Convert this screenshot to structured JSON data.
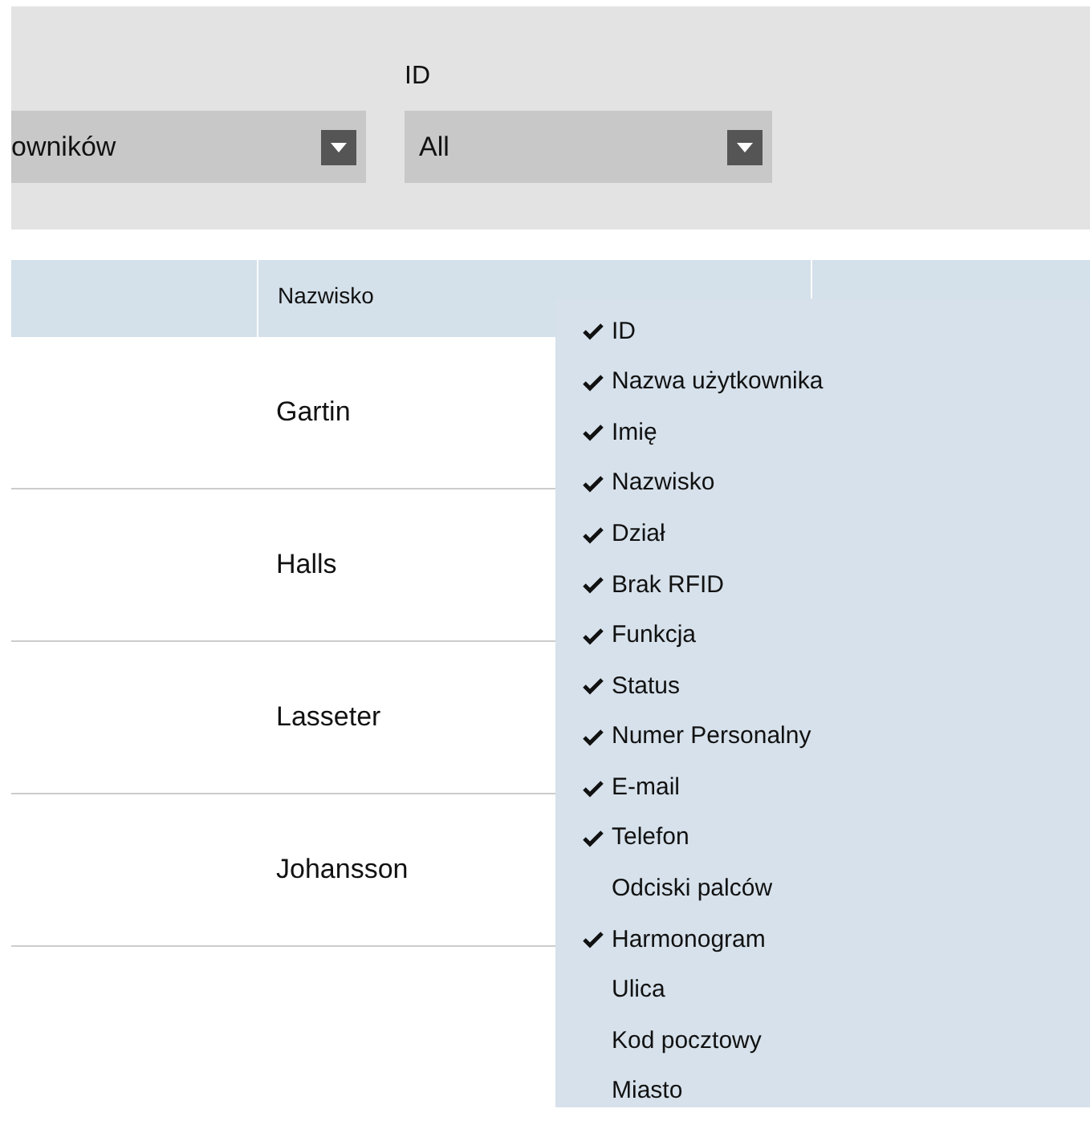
{
  "filters": [
    {
      "value": "owników"
    },
    {
      "label": "ID",
      "value": "All"
    }
  ],
  "table": {
    "columns": [
      "Nazwisko"
    ],
    "rows": [
      {
        "column_2": "Gartin"
      },
      {
        "column_2": "Halls"
      },
      {
        "column_2": "Lasseter"
      },
      {
        "column_2": "Johansson"
      }
    ]
  },
  "column_menu": {
    "items": [
      {
        "label": "ID",
        "checked": true
      },
      {
        "label": "Nazwa użytkownika",
        "checked": true
      },
      {
        "label": "Imię",
        "checked": true
      },
      {
        "label": "Nazwisko",
        "checked": true
      },
      {
        "label": "Dział",
        "checked": true
      },
      {
        "label": "Brak RFID",
        "checked": true
      },
      {
        "label": "Funkcja",
        "checked": true
      },
      {
        "label": "Status",
        "checked": true
      },
      {
        "label": "Numer Personalny",
        "checked": true
      },
      {
        "label": "E-mail",
        "checked": true
      },
      {
        "label": "Telefon",
        "checked": true
      },
      {
        "label": "Odciski palców",
        "checked": false
      },
      {
        "label": "Harmonogram",
        "checked": true
      },
      {
        "label": "Ulica",
        "checked": false
      },
      {
        "label": "Kod pocztowy",
        "checked": false
      },
      {
        "label": "Miasto",
        "checked": false
      }
    ]
  }
}
